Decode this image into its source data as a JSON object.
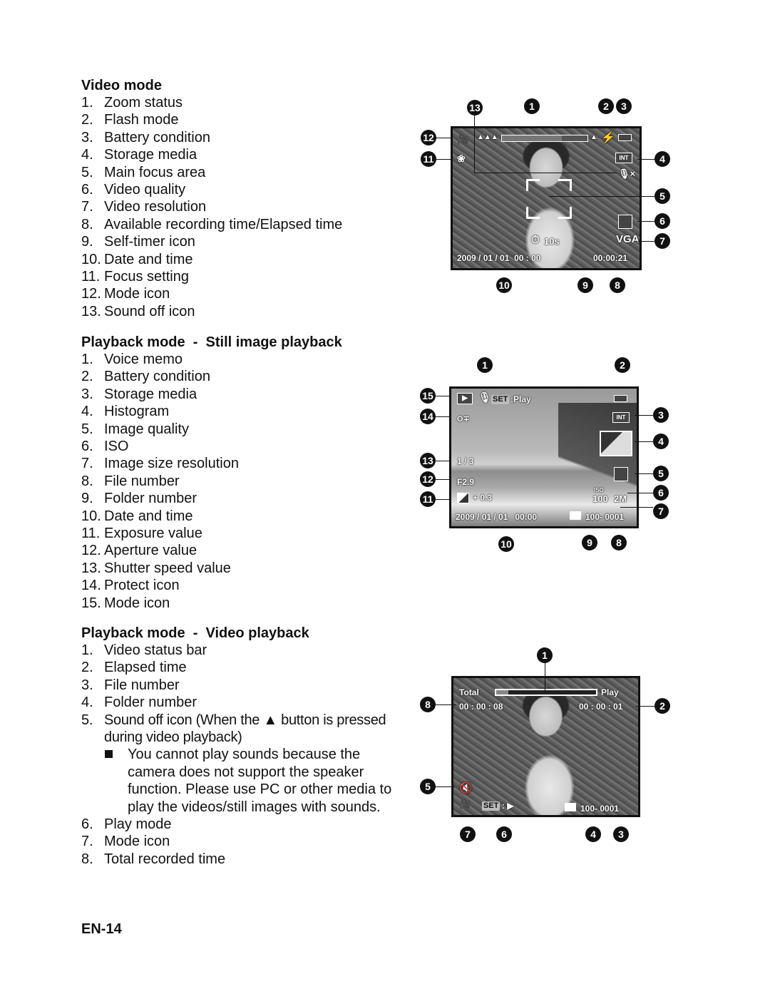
{
  "sections": [
    {
      "title": "Video mode",
      "items": [
        {
          "num": "1.",
          "label": "Zoom status"
        },
        {
          "num": "2.",
          "label": "Flash mode"
        },
        {
          "num": "3.",
          "label": "Battery condition"
        },
        {
          "num": "4.",
          "label": "Storage media"
        },
        {
          "num": "5.",
          "label": "Main focus area"
        },
        {
          "num": "6.",
          "label": "Video quality"
        },
        {
          "num": "7.",
          "label": "Video resolution"
        },
        {
          "num": "8.",
          "label": "Available recording time/Elapsed time"
        },
        {
          "num": "9.",
          "label": "Self-timer icon"
        },
        {
          "num": "10.",
          "label": "Date and time"
        },
        {
          "num": "11.",
          "label": "Focus setting"
        },
        {
          "num": "12.",
          "label": "Mode icon"
        },
        {
          "num": "13.",
          "label": "Sound off icon"
        }
      ]
    },
    {
      "title": "Playback mode  -  Still image playback",
      "items": [
        {
          "num": "1.",
          "label": "Voice memo"
        },
        {
          "num": "2.",
          "label": "Battery condition"
        },
        {
          "num": "3.",
          "label": "Storage media"
        },
        {
          "num": "4.",
          "label": "Histogram"
        },
        {
          "num": "5.",
          "label": "Image quality"
        },
        {
          "num": "6.",
          "label": "ISO"
        },
        {
          "num": "7.",
          "label": "Image size resolution"
        },
        {
          "num": "8.",
          "label": "File number"
        },
        {
          "num": "9.",
          "label": "Folder number"
        },
        {
          "num": "10.",
          "label": "Date and time"
        },
        {
          "num": "11.",
          "label": "Exposure value"
        },
        {
          "num": "12.",
          "label": "Aperture value"
        },
        {
          "num": "13.",
          "label": "Shutter speed value"
        },
        {
          "num": "14.",
          "label": "Protect icon"
        },
        {
          "num": "15.",
          "label": "Mode icon"
        }
      ]
    },
    {
      "title": "Playback mode  -  Video playback",
      "items": [
        {
          "num": "1.",
          "label": "Video status bar"
        },
        {
          "num": "2.",
          "label": "Elapsed time"
        },
        {
          "num": "3.",
          "label": "File number"
        },
        {
          "num": "4.",
          "label": "Folder number"
        },
        {
          "num": "5.",
          "label": "Sound off icon (When the ▲ button is pressed during video playback)"
        },
        {
          "num": "6.",
          "label": "Play mode"
        },
        {
          "num": "7.",
          "label": "Mode icon"
        },
        {
          "num": "8.",
          "label": "Total recorded time"
        }
      ],
      "note": "You cannot play sounds because the camera does not support the speaker function. Please use PC or other media to play the videos/still images with sounds."
    }
  ],
  "screens": {
    "video_mode": {
      "datetime": "2009 / 01 / 01  00 : 00",
      "time_remaining": "00:00:21",
      "self_timer": "10s",
      "resolution": "VGA",
      "storage": "INT",
      "zoom_level": 0.7,
      "callouts": [
        "13",
        "1",
        "2",
        "3",
        "12",
        "11",
        "4",
        "5",
        "6",
        "7",
        "10",
        "9",
        "8"
      ]
    },
    "still_playback": {
      "play_label": ":Play",
      "set_label": "SET",
      "storage": "INT",
      "shutter": "1 / 3",
      "aperture": "F2.9",
      "exposure": "+ 0.3",
      "iso_label": "ISO",
      "iso_value": "100",
      "size": "2M",
      "datetime": "2009 / 01 / 01   00:00",
      "file": "100- 0001",
      "callouts": [
        "1",
        "2",
        "15",
        "14",
        "3",
        "4",
        "13",
        "5",
        "12",
        "6",
        "11",
        "7",
        "10",
        "9",
        "8"
      ]
    },
    "video_playback": {
      "total_label": "Total",
      "play_label": "Play",
      "total_time": "00 : 00 : 08",
      "elapsed_time": "00 : 00 : 01",
      "set_label": "SET",
      "play_glyph": ": ▶",
      "file": "100- 0001",
      "progress": 0.12,
      "callouts": [
        "1",
        "8",
        "2",
        "5",
        "7",
        "6",
        "4",
        "3"
      ]
    }
  },
  "footer": {
    "page": "EN-14"
  }
}
